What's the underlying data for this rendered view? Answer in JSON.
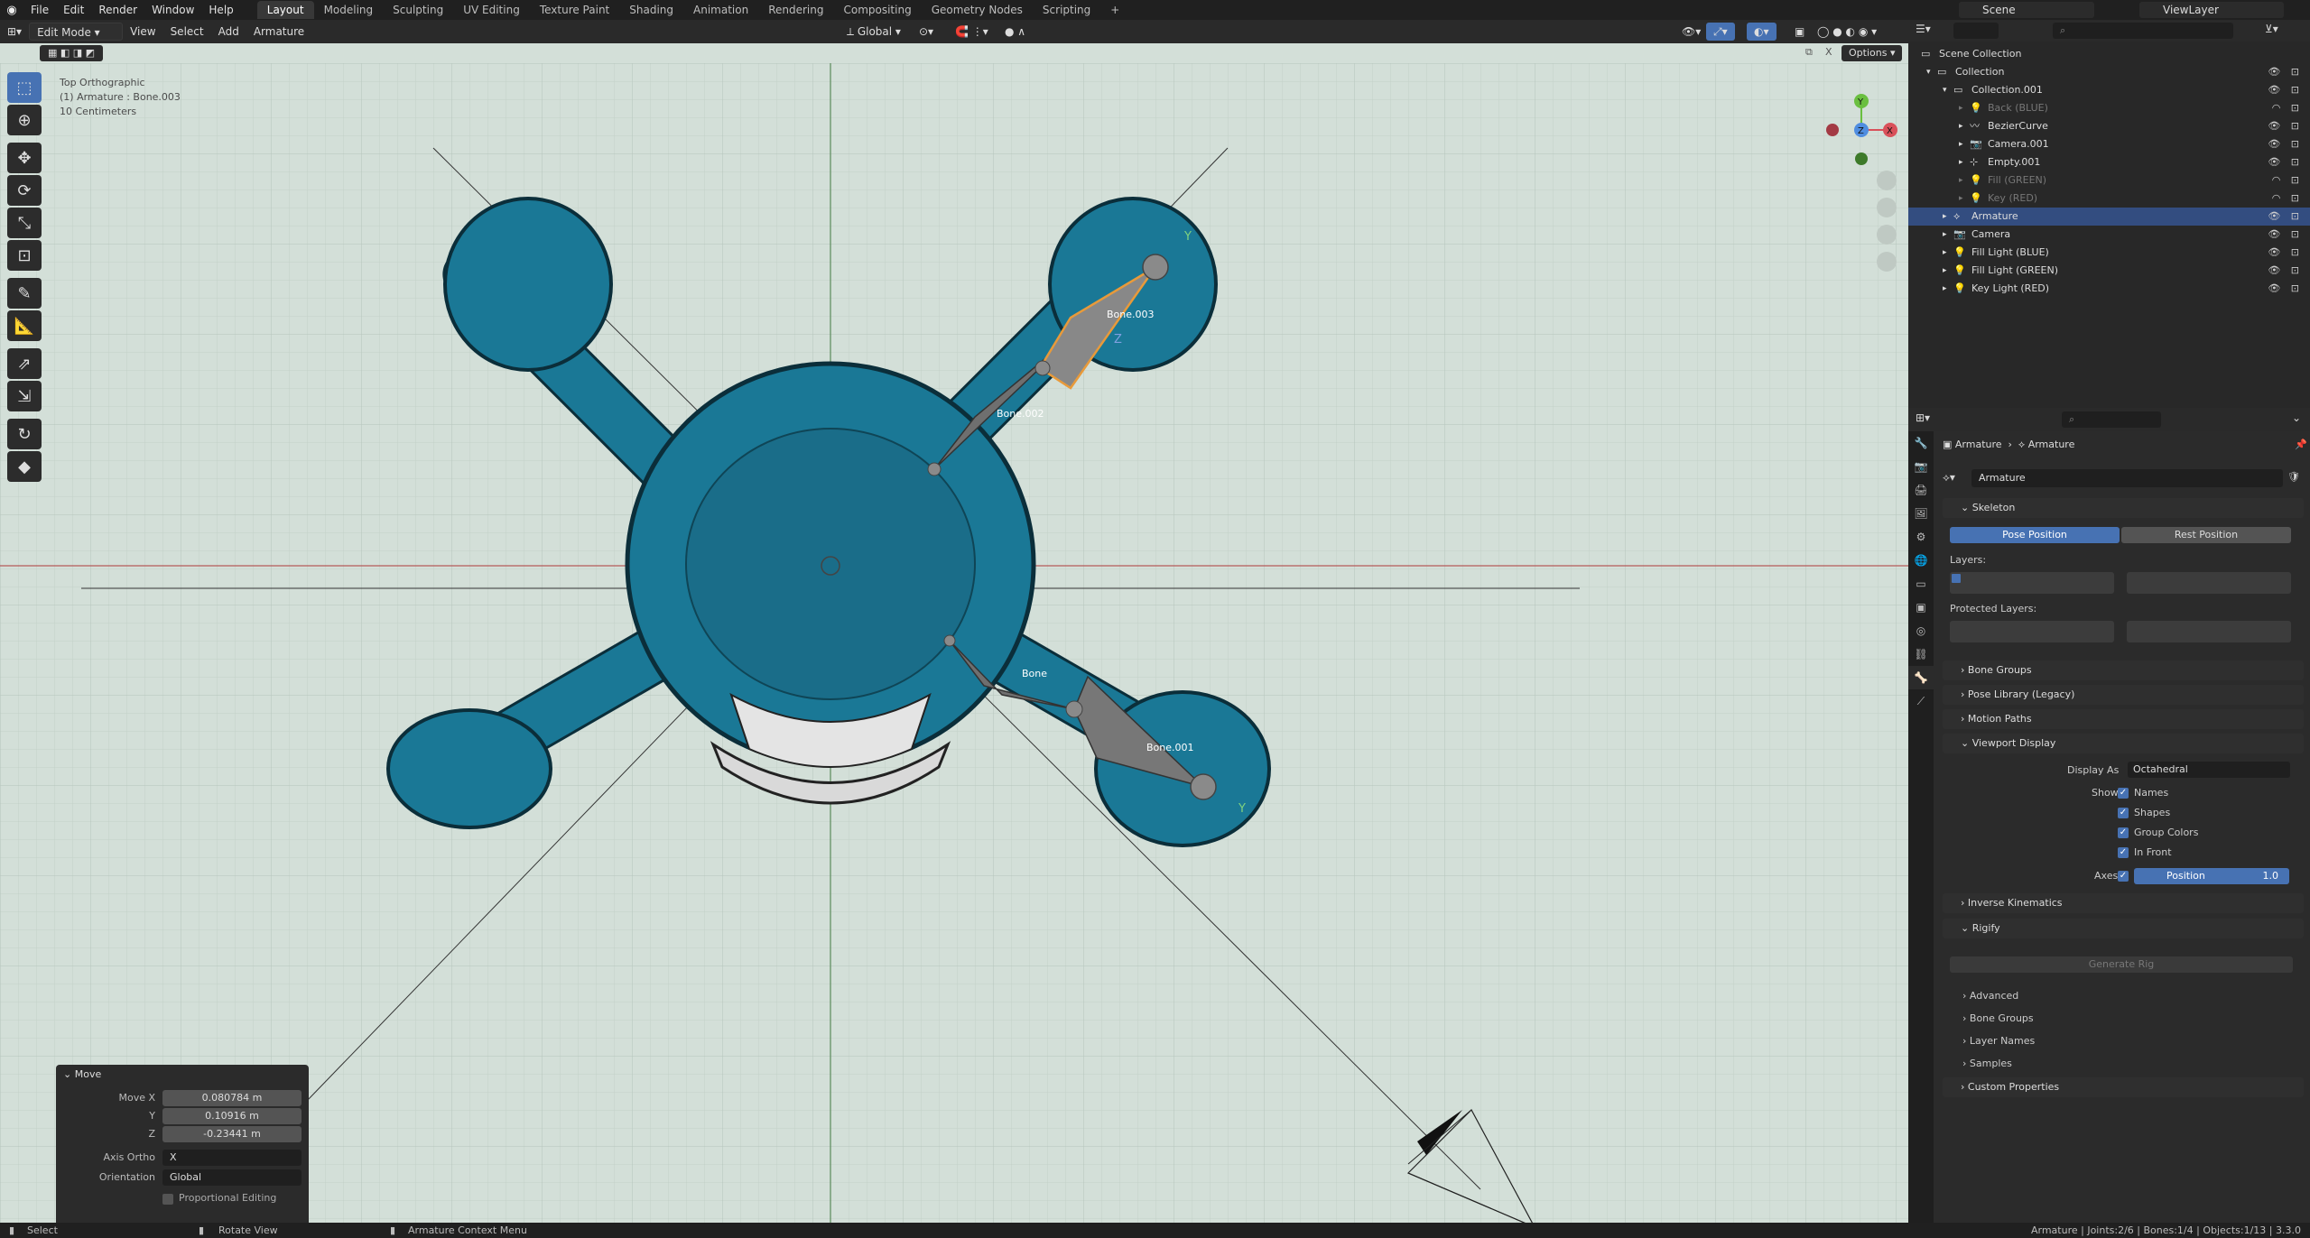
{
  "topbar": {
    "menus": [
      "File",
      "Edit",
      "Render",
      "Window",
      "Help"
    ],
    "workspaces": [
      "Layout",
      "Modeling",
      "Sculpting",
      "UV Editing",
      "Texture Paint",
      "Shading",
      "Animation",
      "Rendering",
      "Compositing",
      "Geometry Nodes",
      "Scripting"
    ],
    "active_workspace": "Layout",
    "add_tab": "+",
    "scene": "Scene",
    "view_layer": "ViewLayer"
  },
  "viewport": {
    "mode": "Edit Mode",
    "menus": [
      "View",
      "Select",
      "Add",
      "Armature"
    ],
    "orientation": "Global",
    "options_label": "Options",
    "x_label": "X",
    "info_lines": [
      "Top Orthographic",
      "(1) Armature : Bone.003",
      "10 Centimeters"
    ],
    "gizmo": {
      "x": "X",
      "y": "Y",
      "z": "Z"
    },
    "bones": [
      {
        "name": "Bone.003"
      },
      {
        "name": "Bone"
      },
      {
        "name": "Bone.001"
      },
      {
        "name": "Bone.002"
      }
    ],
    "axis_labels": {
      "y": "Y",
      "z": "Z"
    }
  },
  "operator_panel": {
    "title": "Move",
    "move_x_label": "Move X",
    "move_x": "0.080784 m",
    "y_label": "Y",
    "y": "0.10916 m",
    "z_label": "Z",
    "z": "-0.23441 m",
    "axis_ortho_label": "Axis Ortho",
    "axis_ortho": "X",
    "orientation_label": "Orientation",
    "orientation": "Global",
    "proportional_label": "Proportional Editing"
  },
  "outliner": {
    "search_placeholder": "",
    "items": [
      {
        "label": "Scene Collection",
        "indent": 0,
        "state": "normal"
      },
      {
        "label": "Collection",
        "indent": 1,
        "state": "normal"
      },
      {
        "label": "Collection.001",
        "indent": 2,
        "state": "normal"
      },
      {
        "label": "Back (BLUE)",
        "indent": 3,
        "state": "dim"
      },
      {
        "label": "BezierCurve",
        "indent": 3,
        "state": "normal"
      },
      {
        "label": "Camera.001",
        "indent": 3,
        "state": "normal"
      },
      {
        "label": "Empty.001",
        "indent": 3,
        "state": "normal"
      },
      {
        "label": "Fill (GREEN)",
        "indent": 3,
        "state": "dim"
      },
      {
        "label": "Key (RED)",
        "indent": 3,
        "state": "dim"
      },
      {
        "label": "Armature",
        "indent": 2,
        "state": "selected"
      },
      {
        "label": "Camera",
        "indent": 2,
        "state": "normal"
      },
      {
        "label": "Fill Light (BLUE)",
        "indent": 2,
        "state": "normal"
      },
      {
        "label": "Fill Light (GREEN)",
        "indent": 2,
        "state": "normal"
      },
      {
        "label": "Key Light (RED)",
        "indent": 2,
        "state": "normal"
      }
    ]
  },
  "properties": {
    "breadcrumb_1": "Armature",
    "breadcrumb_2": "Armature",
    "data_name": "Armature",
    "skeleton": "Skeleton",
    "pose_position": "Pose Position",
    "rest_position": "Rest Position",
    "layers_label": "Layers:",
    "protected_layers_label": "Protected Layers:",
    "bone_groups": "Bone Groups",
    "pose_library": "Pose Library (Legacy)",
    "motion_paths": "Motion Paths",
    "viewport_display": "Viewport Display",
    "display_as_label": "Display As",
    "display_as": "Octahedral",
    "show_label": "Show",
    "names": "Names",
    "shapes": "Shapes",
    "group_colors": "Group Colors",
    "in_front": "In Front",
    "axes_label": "Axes",
    "position_label": "Position",
    "position_value": "1.0",
    "inverse_kinematics": "Inverse Kinematics",
    "rigify": "Rigify",
    "generate_rig": "Generate Rig",
    "advanced": "Advanced",
    "rigify_bone_groups": "Bone Groups",
    "layer_names": "Layer Names",
    "samples": "Samples",
    "custom_properties": "Custom Properties"
  },
  "statusbar": {
    "select": "Select",
    "rotate": "Rotate View",
    "context": "Armature Context Menu",
    "stats": "Armature | Joints:2/6 | Bones:1/4 | Objects:1/13 | 3.3.0"
  },
  "colors": {
    "viewport_bg": "#d3dfd8",
    "body_teal": "#1a7896",
    "selected_blue": "#4772b3",
    "bone_gray": "#6f6f6f",
    "bone_selected": "#e89a3a"
  }
}
